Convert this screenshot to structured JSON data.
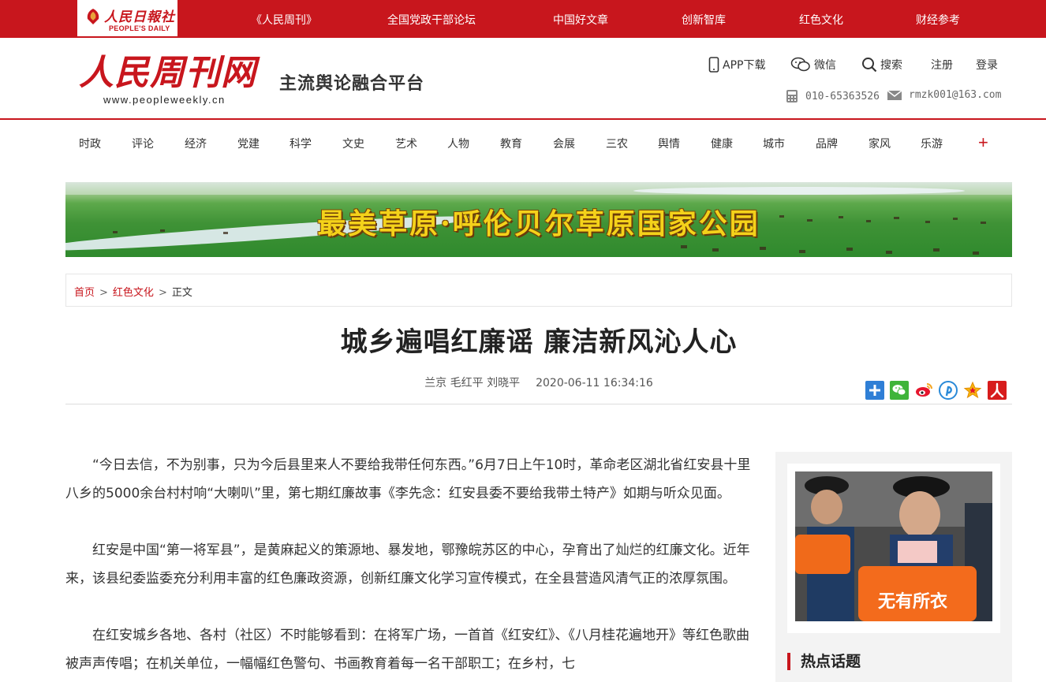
{
  "colors": {
    "brand_red": "#c8161d",
    "banner_text": "#f4d21a"
  },
  "top_bar": {
    "logo_cn": "人民日報社",
    "logo_en": "PEOPLE'S DAILY",
    "links": [
      "《人民周刊》",
      "全国党政干部论坛",
      "中国好文章",
      "创新智库",
      "红色文化",
      "财经参考"
    ]
  },
  "header": {
    "brand": "人民周刊网",
    "url": "www.peopleweekly.cn",
    "slogan": "主流舆论融合平台",
    "app_label": "APP下载",
    "wechat_label": "微信",
    "search_label": "搜索",
    "register_label": "注册",
    "login_label": "登录",
    "phone": "010-65363526",
    "email": "rmzk001@163.com"
  },
  "nav": {
    "items": [
      "时政",
      "评论",
      "经济",
      "党建",
      "科学",
      "文史",
      "艺术",
      "人物",
      "教育",
      "会展",
      "三农",
      "舆情",
      "健康",
      "城市",
      "品牌",
      "家风",
      "乐游"
    ],
    "more": "+"
  },
  "banner": {
    "title": "最美草原·呼伦贝尔草原国家公园"
  },
  "breadcrumb": {
    "home": "首页",
    "category": "红色文化",
    "current": "正文",
    "separator": ">"
  },
  "article": {
    "title": "城乡遍唱红廉谣 廉洁新风沁人心",
    "authors": "兰京 毛红平 刘晓平",
    "datetime": "2020-06-11 16:34:16",
    "paragraphs": [
      "“今日去信，不为别事，只为今后县里来人不要给我带任何东西。”6月7日上午10时，革命老区湖北省红安县十里八乡的5000余台村村响“大喇叭”里，第七期红廉故事《李先念：红安县委不要给我带土特产》如期与听众见面。",
      "红安是中国“第一将军县”，是黄麻起义的策源地、暴发地，鄂豫皖苏区的中心，孕育出了灿烂的红廉文化。近年来，该县纪委监委充分利用丰富的红色廉政资源，创新红廉文化学习宣传模式，在全县营造风清气正的浓厚氛围。",
      "在红安城乡各地、各村（社区）不时能够看到：在将军广场，一首首《红安红》、《八月桂花遍地开》等红色歌曲被声声传唱；在机关单位，一幅幅红色警句、书画教育着每一名干部职工；在乡村，七"
    ]
  },
  "share_icons": [
    "share-plus-icon",
    "wechat-icon",
    "weibo-icon",
    "pinterest-icon",
    "favorite-star-icon",
    "renren-icon"
  ],
  "sidebar": {
    "photo_bag_text": "无有所衣",
    "hot_topics_title": "热点话题"
  }
}
